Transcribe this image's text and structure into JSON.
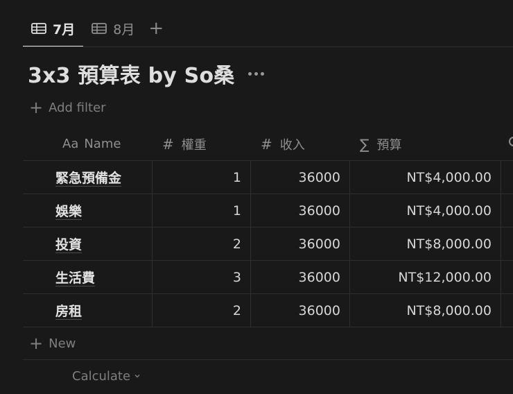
{
  "tabs": [
    {
      "label": "7月",
      "icon": "table-icon",
      "active": true
    },
    {
      "label": "8月",
      "icon": "table-icon",
      "active": false
    }
  ],
  "add_view_icon": "plus-icon",
  "page": {
    "title": "3x3 預算表 by So桑",
    "more_icon": "ellipsis-icon"
  },
  "filter": {
    "label": "Add filter",
    "icon": "plus-icon"
  },
  "table": {
    "headers": [
      {
        "icon": "Aa",
        "label": "Name"
      },
      {
        "icon": "#",
        "label": "權重"
      },
      {
        "icon": "#",
        "label": "收入"
      },
      {
        "icon": "∑",
        "label": "預算"
      }
    ],
    "rows": [
      {
        "name": "緊急預備金",
        "weight": "1",
        "income": "36000",
        "budget": "NT$4,000.00"
      },
      {
        "name": "娛樂",
        "weight": "1",
        "income": "36000",
        "budget": "NT$4,000.00"
      },
      {
        "name": "投資",
        "weight": "2",
        "income": "36000",
        "budget": "NT$8,000.00"
      },
      {
        "name": "生活費",
        "weight": "3",
        "income": "36000",
        "budget": "NT$12,000.00"
      },
      {
        "name": "房租",
        "weight": "2",
        "income": "36000",
        "budget": "NT$8,000.00"
      }
    ],
    "new_row_label": "New",
    "calculate_label": "Calculate"
  },
  "colors": {
    "background": "#191919",
    "text": "#d7d7d7",
    "muted": "#8f8f8f",
    "divider": "#2f2f2f"
  }
}
